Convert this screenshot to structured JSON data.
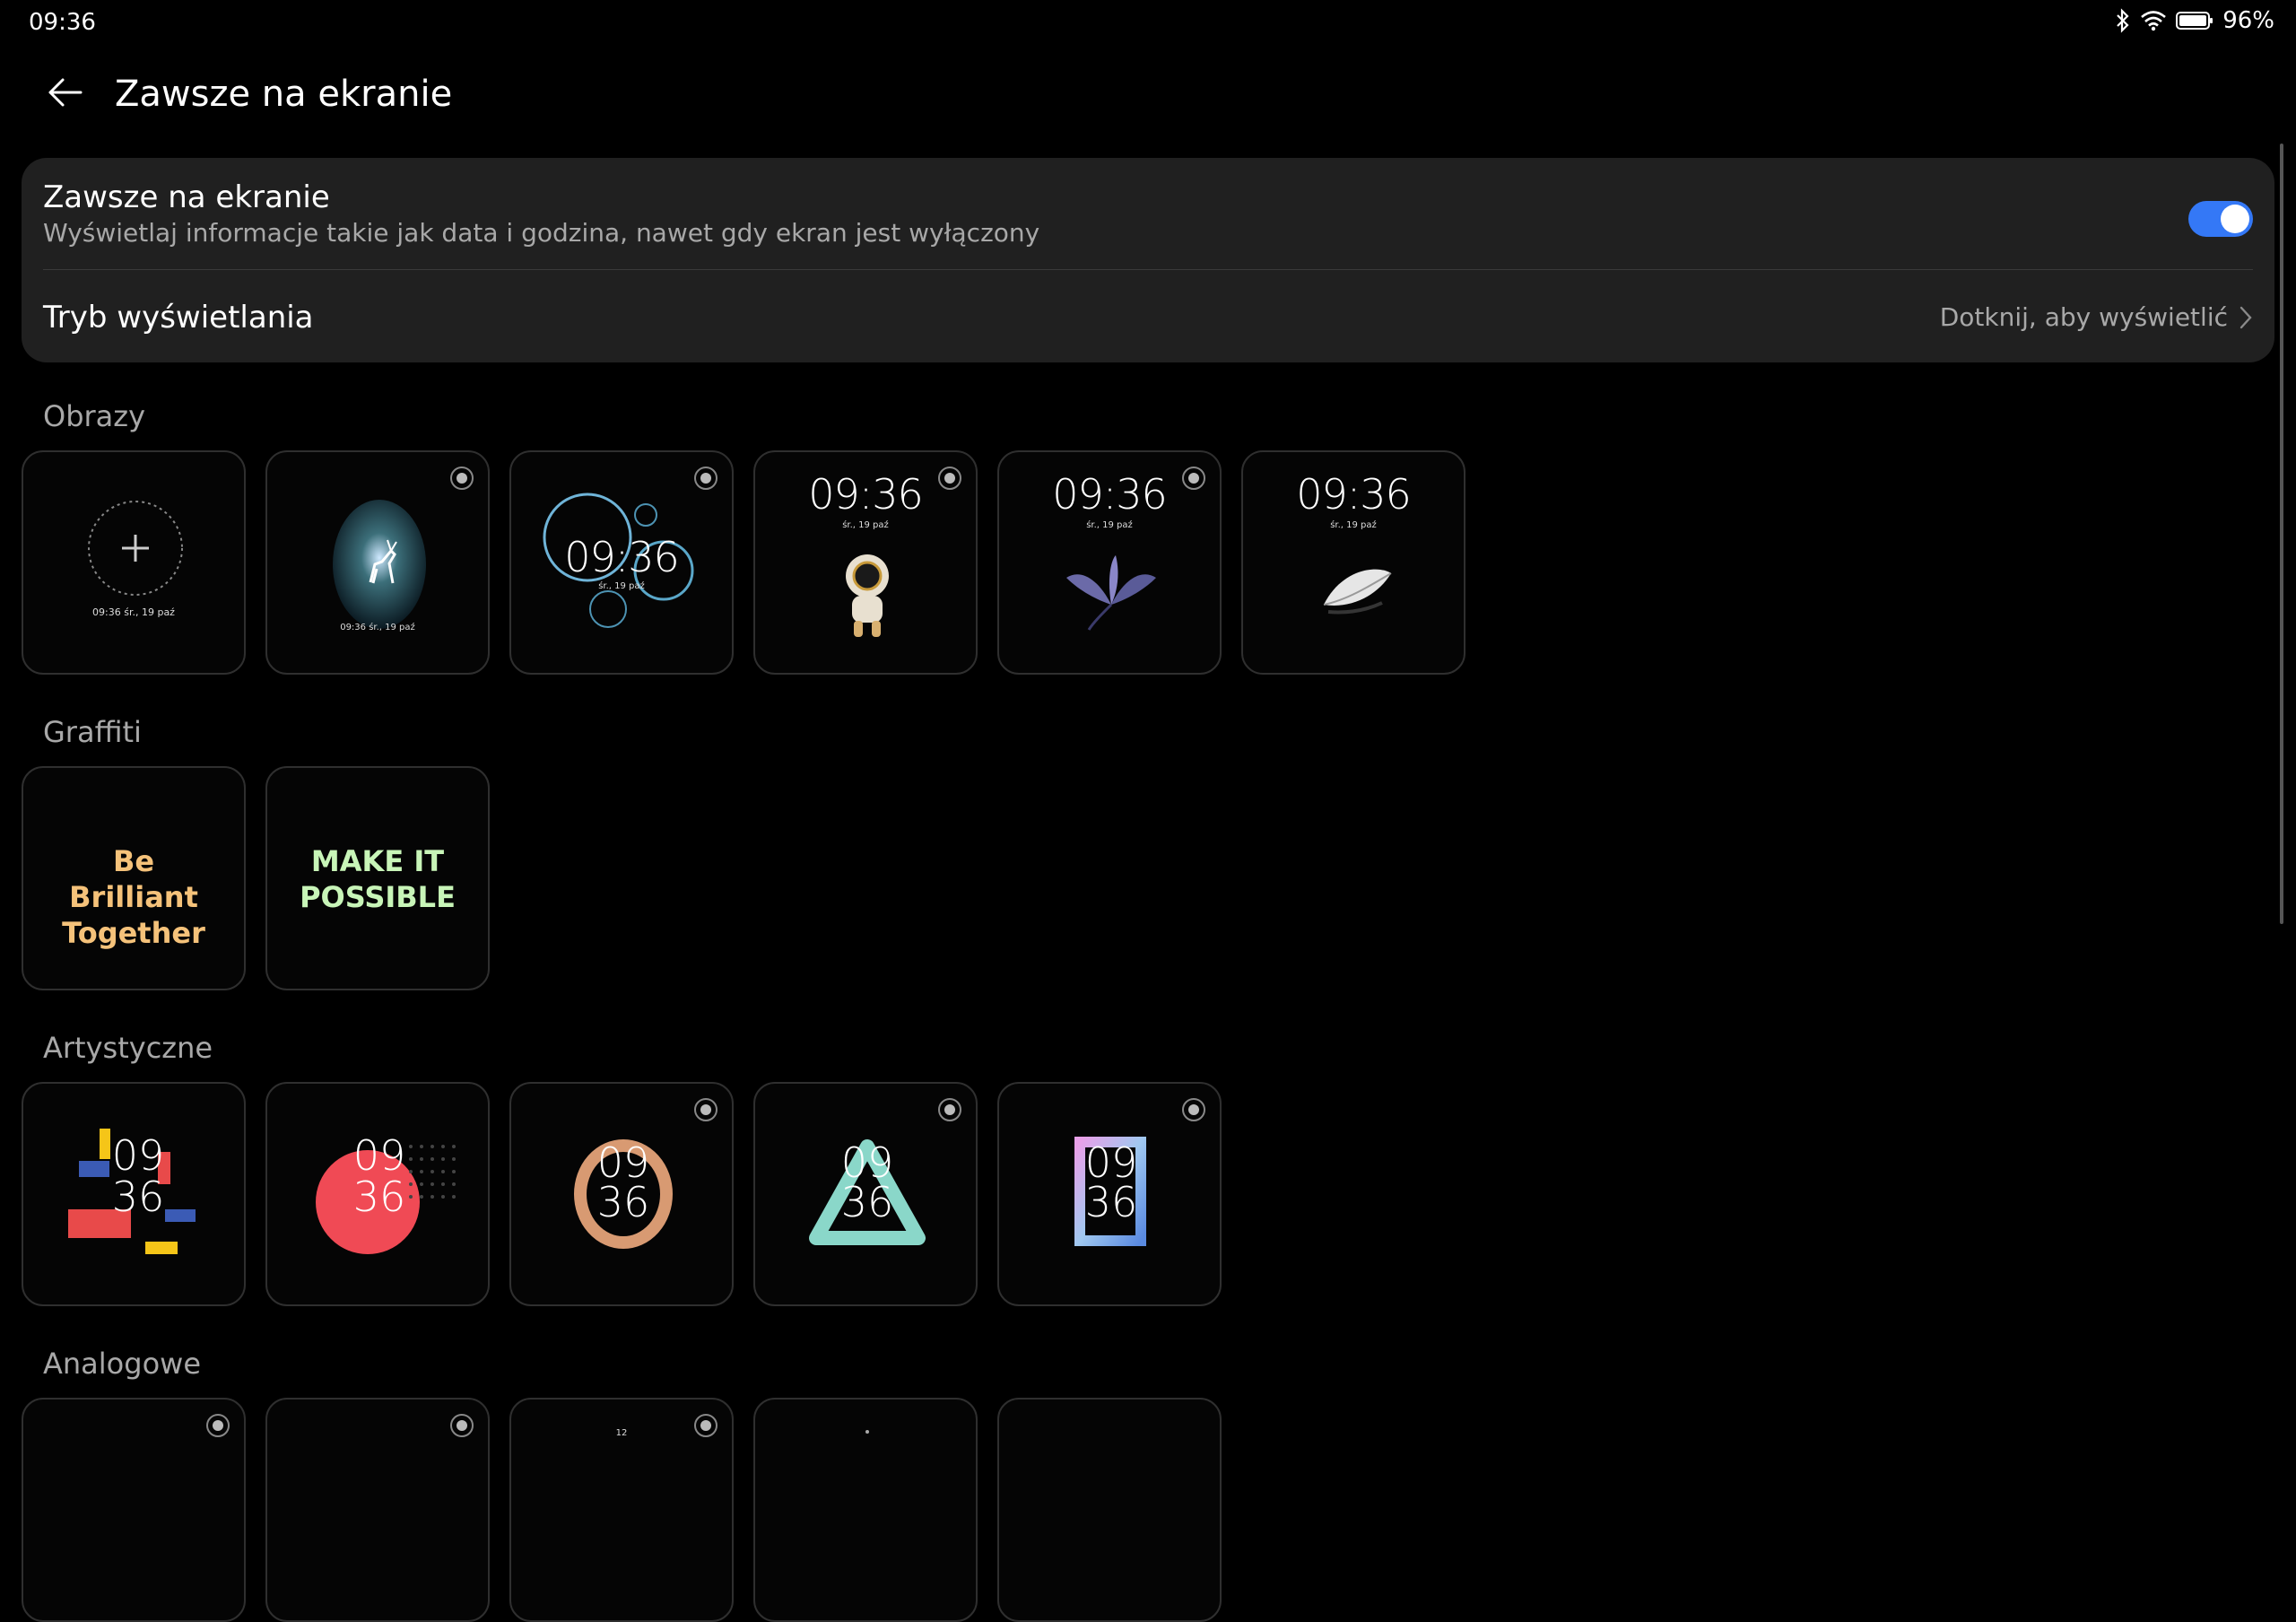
{
  "status": {
    "time": "09:36",
    "battery": "96%"
  },
  "header": {
    "title": "Zawsze na ekranie"
  },
  "settings": {
    "aod_title": "Zawsze na ekranie",
    "aod_subtitle": "Wyświetlaj informacje takie jak data i godzina, nawet gdy ekran jest wyłączony",
    "aod_enabled": true,
    "mode_title": "Tryb wyświetlania",
    "mode_value": "Dotknij, aby wyświetlić"
  },
  "sections": {
    "images": {
      "label": "Obrazy",
      "tile_time": "09:36",
      "tile_date": "śr., 19 paź",
      "add_caption": "09:36 śr., 19 paź",
      "deer_caption": "09:36 śr., 19 paź"
    },
    "graffiti": {
      "label": "Graffiti",
      "tile1_text": "Be Brilliant Together",
      "tile2_text": "MAKE IT POSSIBLE"
    },
    "artistic": {
      "label": "Artystyczne",
      "hour": "09",
      "minute": "36"
    },
    "analog": {
      "label": "Analogowe",
      "dial_top": "12"
    }
  },
  "colors": {
    "accent": "#3478f6",
    "card_bg": "#202020",
    "graffiti1": "#f5c27a",
    "graffiti2": "#c8f5b8"
  }
}
